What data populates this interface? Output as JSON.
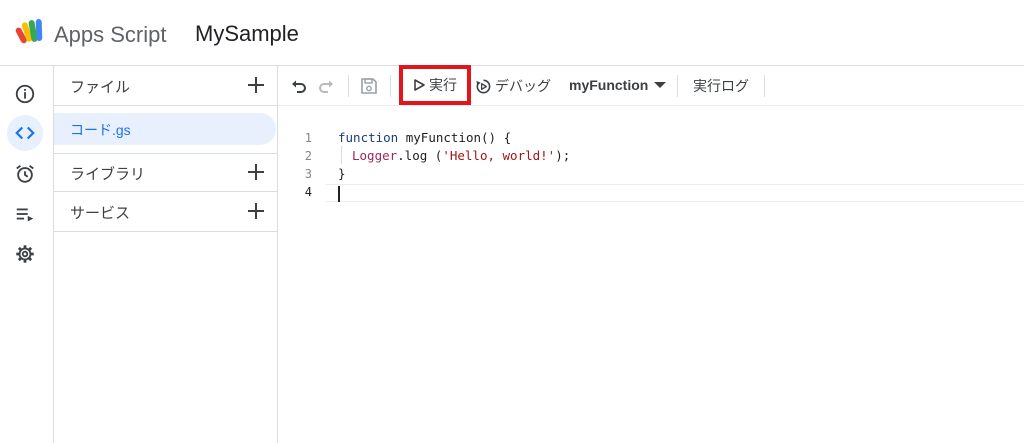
{
  "header": {
    "app_name": "Apps Script",
    "project_name": "MySample",
    "logo_colors": [
      "#ea4335",
      "#fbbc04",
      "#34a853",
      "#4285f4"
    ]
  },
  "rail": {
    "items": [
      {
        "icon": "info-icon",
        "active": false
      },
      {
        "icon": "code-icon",
        "active": true
      },
      {
        "icon": "alarm-clock-icon",
        "active": false
      },
      {
        "icon": "executions-icon",
        "active": false
      },
      {
        "icon": "gear-icon",
        "active": false
      }
    ]
  },
  "sidebar": {
    "files_label": "ファイル",
    "file_name": "コード.gs",
    "libraries_label": "ライブラリ",
    "services_label": "サービス"
  },
  "toolbar": {
    "run_label": "実行",
    "debug_label": "デバッグ",
    "function_name": "myFunction",
    "log_label": "実行ログ"
  },
  "editor": {
    "line_numbers": [
      "1",
      "2",
      "3",
      "4"
    ],
    "code": {
      "l1_kw": "function",
      "l1_rest": " myFunction() {",
      "l2_obj": "Logger",
      "l2_mid": ".log (",
      "l2_str": "'Hello, world!'",
      "l2_end": ");",
      "l3": "}"
    }
  },
  "colors": {
    "accent": "#1a73e8",
    "active_bg": "#e8f0fe",
    "highlight_box": "#e4141b"
  }
}
